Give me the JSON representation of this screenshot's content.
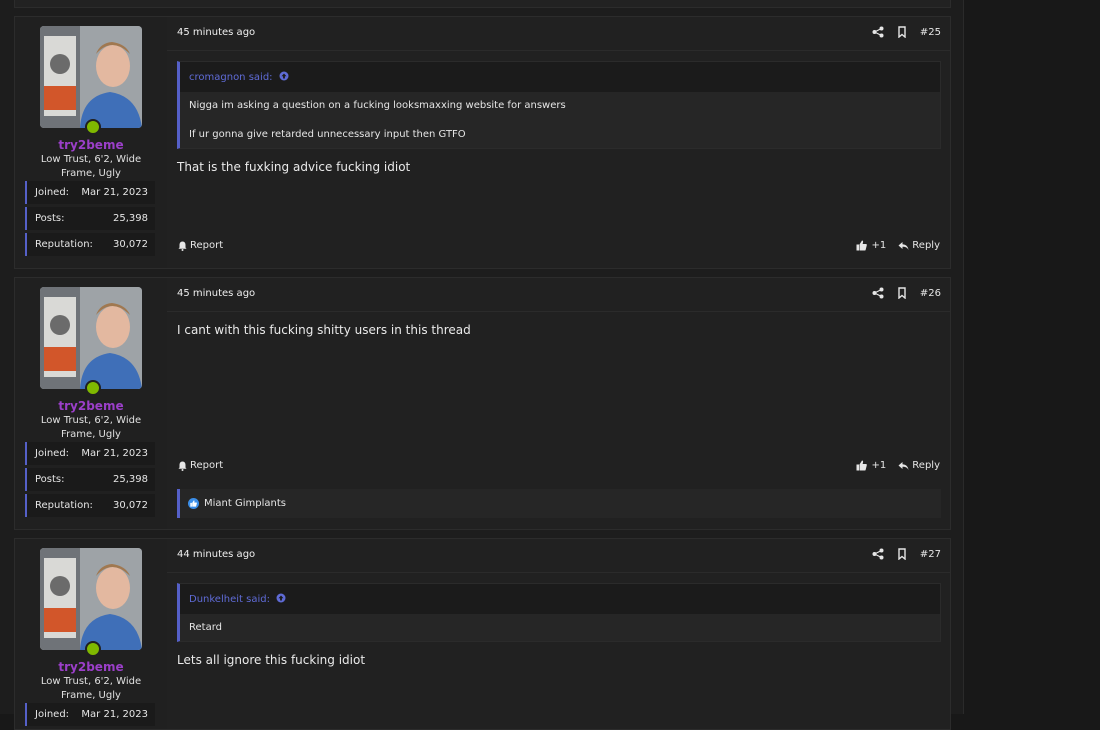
{
  "posts": [
    {
      "username": "try2beme",
      "user_title": "Low Trust, 6'2, Wide Frame, Ugly",
      "stats": [
        {
          "label": "Joined:",
          "value": "Mar 21, 2023"
        },
        {
          "label": "Posts:",
          "value": "25,398"
        },
        {
          "label": "Reputation:",
          "value": "30,072"
        }
      ],
      "time": "45 minutes ago",
      "number": "#25",
      "quote": {
        "author": "cromagnon said:",
        "lines": [
          "Nigga im asking a question on a fucking looksmaxxing website for answers",
          "If ur gonna give retarded unnecessary input then GTFO"
        ]
      },
      "content": "That is the fuxking advice fucking idiot",
      "report_label": "Report",
      "reaction_count": "+1",
      "reply_label": "Reply"
    },
    {
      "username": "try2beme",
      "user_title": "Low Trust, 6'2, Wide Frame, Ugly",
      "stats": [
        {
          "label": "Joined:",
          "value": "Mar 21, 2023"
        },
        {
          "label": "Posts:",
          "value": "25,398"
        },
        {
          "label": "Reputation:",
          "value": "30,072"
        }
      ],
      "time": "45 minutes ago",
      "number": "#26",
      "content": "I cant with this fucking shitty users in this thread",
      "report_label": "Report",
      "reaction_count": "+1",
      "reply_label": "Reply",
      "reacted_by": "Miant Gimplants"
    },
    {
      "username": "try2beme",
      "user_title": "Low Trust, 6'2, Wide Frame, Ugly",
      "stats": [
        {
          "label": "Joined:",
          "value": "Mar 21, 2023"
        }
      ],
      "time": "44 minutes ago",
      "number": "#27",
      "quote": {
        "author": "Dunkelheit said:",
        "lines": [
          "Retard"
        ]
      },
      "content": "Lets all ignore this fucking idiot"
    }
  ],
  "colors": {
    "username": "#9b3fc9",
    "accent": "#5560c8",
    "online": "#7fb800"
  }
}
